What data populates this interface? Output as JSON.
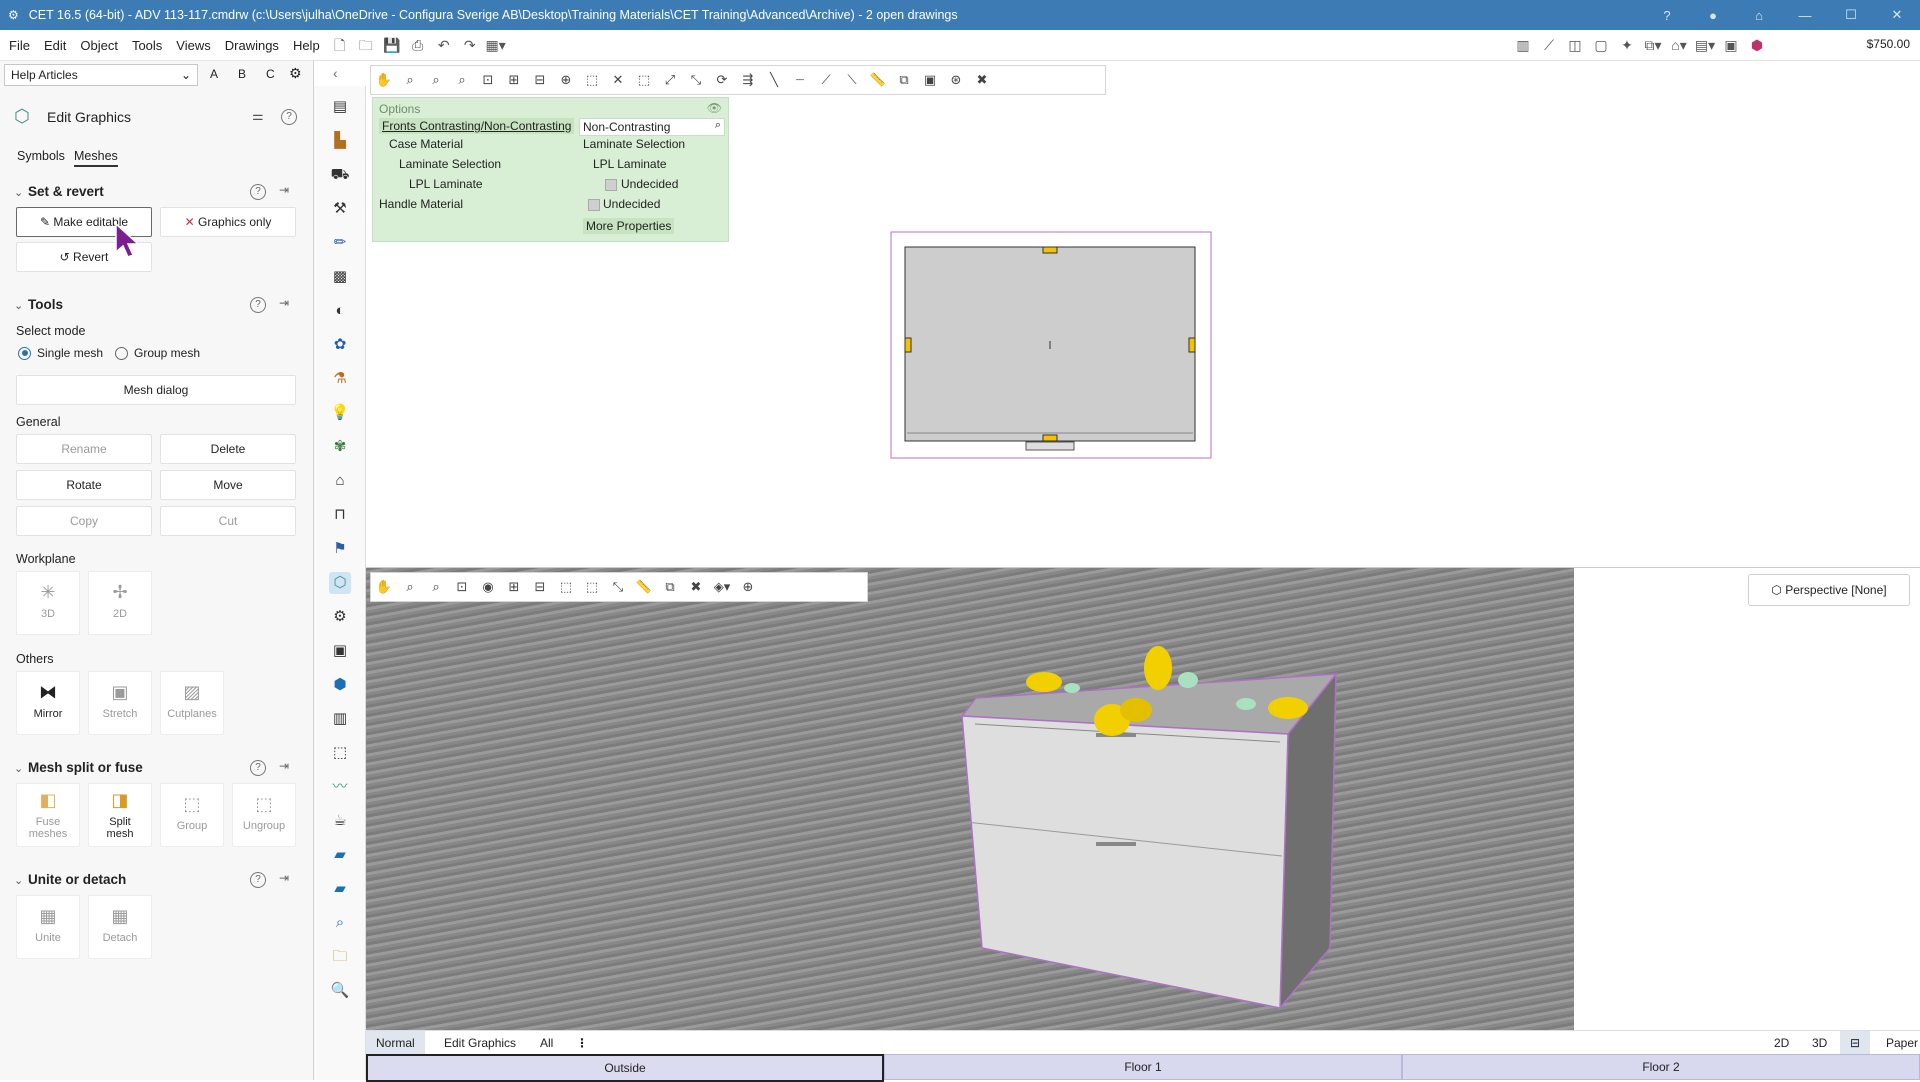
{
  "window": {
    "title": "CET 16.5 (64-bit) - ADV 113-117.cmdrw (c:\\Users\\julha\\OneDrive - Configura Sverige AB\\Desktop\\Training Materials\\CET Training\\Advanced\\Archive) - 2  open drawings",
    "controls": [
      "?",
      "●",
      "⌂",
      "—",
      "☐",
      "✕"
    ]
  },
  "menu": {
    "items": [
      "File",
      "Edit",
      "Object",
      "Tools",
      "Views",
      "Drawings",
      "Help"
    ],
    "price": "$750.00"
  },
  "left": {
    "dropdown_value": "Help Articles",
    "letters": [
      "A",
      "B",
      "C"
    ],
    "panel_title": "Edit Graphics",
    "tabs": [
      "Symbols",
      "Meshes"
    ],
    "active_tab": "Meshes",
    "set_revert": {
      "title": "Set & revert",
      "make_editable": "Make editable",
      "graphics_only": "Graphics only",
      "revert": "Revert"
    },
    "tools": {
      "title": "Tools",
      "select_mode_label": "Select mode",
      "single_mesh": "Single mesh",
      "group_mesh": "Group mesh",
      "mesh_dialog": "Mesh dialog",
      "general_label": "General",
      "rename": "Rename",
      "delete": "Delete",
      "rotate": "Rotate",
      "move": "Move",
      "copy": "Copy",
      "cut": "Cut",
      "workplane_label": "Workplane",
      "wp_3d": "3D",
      "wp_2d": "2D",
      "others_label": "Others",
      "mirror": "Mirror",
      "stretch": "Stretch",
      "cutplanes": "Cutplanes"
    },
    "split_fuse": {
      "title": "Mesh split or fuse",
      "fuse": "Fuse meshes",
      "split": "Split mesh",
      "group": "Group",
      "ungroup": "Ungroup"
    },
    "unite_detach": {
      "title": "Unite or detach",
      "unite": "Unite",
      "detach": "Detach"
    }
  },
  "properties": {
    "header": "Options",
    "rows": [
      {
        "label": "Fronts Contrasting/Non-Contrasting",
        "value": "Non-Contrasting"
      },
      {
        "label": "Case Material",
        "value": "Laminate Selection"
      },
      {
        "label": "Laminate Selection",
        "value": "LPL Laminate"
      },
      {
        "label": "LPL Laminate",
        "value": "Undecided"
      },
      {
        "label": "Handle Material",
        "value": "Undecided"
      }
    ],
    "more": "More Properties"
  },
  "view3d": {
    "perspective": "Perspective [None]"
  },
  "bottom": {
    "tabs": [
      "Normal",
      "Edit Graphics",
      "All"
    ],
    "right": [
      "2D",
      "3D",
      "Paper"
    ],
    "floors": [
      "Outside",
      "Floor 1",
      "Floor 2"
    ]
  }
}
